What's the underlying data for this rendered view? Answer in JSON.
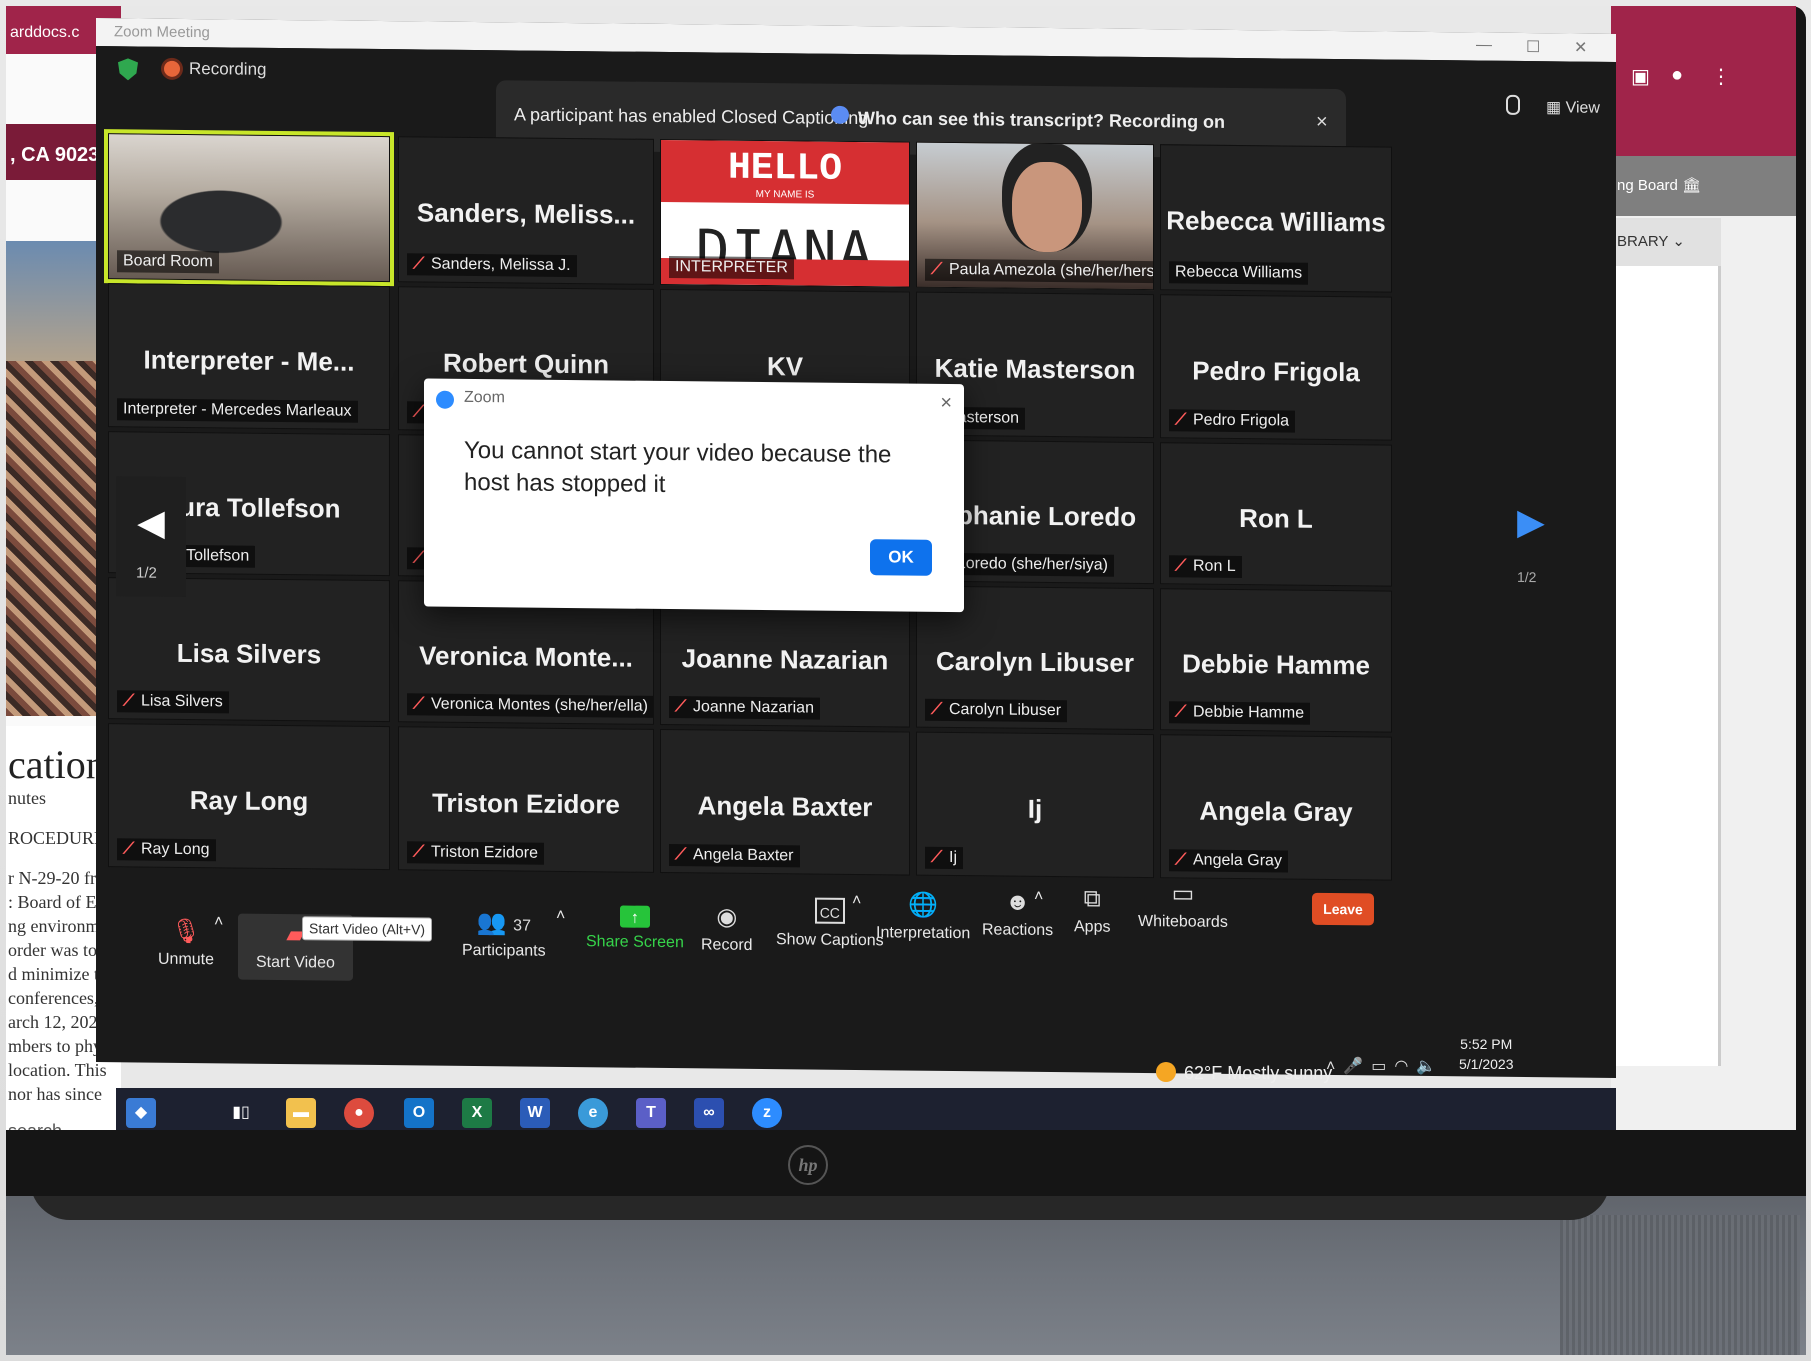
{
  "app": {
    "title": "Zoom Meeting",
    "recording_label": "Recording",
    "view_label": "View"
  },
  "banner": {
    "text": "A participant has enabled Closed Captioning",
    "link": "Who can see this transcript? Recording on",
    "close": "×"
  },
  "browser": {
    "tab_text": "arddocs.c",
    "address_text": ", CA 9023",
    "right_tab1": "ng Board",
    "right_tab2": "BRARY",
    "doc_big": "cation",
    "doc_lines": [
      "nutes",
      "ROCEDURES",
      "r N-29-20 fr",
      ": Board of Ed",
      "ng environm",
      "order was to",
      "d minimize th",
      "conferences,",
      "arch 12, 2020",
      "mbers to phy",
      "location. This",
      "nor has since"
    ],
    "search": "search"
  },
  "tiles": [
    {
      "big": "",
      "small": "Board Room",
      "muted": false,
      "kind": "board"
    },
    {
      "big": "Sanders,  Meliss...",
      "small": "Sanders, Melissa J.",
      "muted": true,
      "kind": "name"
    },
    {
      "big": "",
      "small": "INTERPRETER",
      "muted": false,
      "kind": "hello"
    },
    {
      "big": "",
      "small": "Paula Amezola (she/her/hers)",
      "muted": true,
      "kind": "paula"
    },
    {
      "big": "Rebecca Williams",
      "small": "Rebecca Williams",
      "muted": false,
      "kind": "name"
    },
    {
      "big": "Interpreter  -  Me...",
      "small": "Interpreter - Mercedes Marleaux",
      "muted": false,
      "kind": "name"
    },
    {
      "big": "Robert Quinn",
      "small": "",
      "muted": true,
      "kind": "name"
    },
    {
      "big": "KV",
      "small": "",
      "muted": false,
      "kind": "name"
    },
    {
      "big": "Katie Masterson",
      "small": "e Masterson",
      "muted": false,
      "kind": "name"
    },
    {
      "big": "Pedro Frigola",
      "small": "Pedro Frigola",
      "muted": true,
      "kind": "name"
    },
    {
      "big": ".aura Tollefson",
      "small": "Laura Tollefson",
      "muted": true,
      "kind": "name"
    },
    {
      "big": "",
      "small": "",
      "muted": true,
      "kind": "name"
    },
    {
      "big": "",
      "small": "",
      "muted": false,
      "kind": "name"
    },
    {
      "big": "tephanie Loredo",
      "small": "nie Loredo (she/her/siya)",
      "muted": false,
      "kind": "name"
    },
    {
      "big": "Ron L",
      "small": "Ron L",
      "muted": true,
      "kind": "name"
    },
    {
      "big": "Lisa Silvers",
      "small": "Lisa Silvers",
      "muted": true,
      "kind": "name"
    },
    {
      "big": "Veronica  Monte...",
      "small": "Veronica Montes (she/her/ella)",
      "muted": true,
      "kind": "name"
    },
    {
      "big": "Joanne Nazarian",
      "small": "Joanne Nazarian",
      "muted": true,
      "kind": "name"
    },
    {
      "big": "Carolyn Libuser",
      "small": "Carolyn Libuser",
      "muted": true,
      "kind": "name"
    },
    {
      "big": "Debbie Hamme",
      "small": "Debbie Hamme",
      "muted": true,
      "kind": "name"
    },
    {
      "big": "Ray Long",
      "small": "Ray Long",
      "muted": true,
      "kind": "name"
    },
    {
      "big": "Triston Ezidore",
      "small": "Triston Ezidore",
      "muted": true,
      "kind": "name"
    },
    {
      "big": "Angela Baxter",
      "small": "Angela Baxter",
      "muted": true,
      "kind": "name"
    },
    {
      "big": "Ij",
      "small": "Ij",
      "muted": true,
      "kind": "name"
    },
    {
      "big": "Angela Gray",
      "small": "Angela Gray",
      "muted": true,
      "kind": "name"
    }
  ],
  "hello_badge": {
    "hello": "HELLO",
    "my_name_is": "MY NAME IS",
    "name": "DIANA"
  },
  "pagination": {
    "prev": "1/2",
    "next": "1/2"
  },
  "dialog": {
    "title": "Zoom",
    "message": "You cannot start your video because the host has stopped it",
    "ok": "OK",
    "close": "×"
  },
  "toolbar": {
    "unmute": "Unmute",
    "start_video": "Start Video",
    "tooltip": "Start Video (Alt+V)",
    "participants": "Participants",
    "participants_count": "37",
    "share_screen": "Share Screen",
    "record": "Record",
    "show_captions": "Show Captions",
    "interpretation": "Interpretation",
    "reactions": "Reactions",
    "apps": "Apps",
    "whiteboards": "Whiteboards",
    "leave": "Leave",
    "cc": "CC"
  },
  "taskbar": {
    "weather": "62°F  Mostly sunny",
    "time": "5:52 PM",
    "date": "5/1/2023"
  },
  "colors": {
    "accent_blue": "#0e72ed",
    "leave_red": "#e04d24",
    "share_green": "#26c43a",
    "mute_red": "#ff5b5b",
    "browser_brand": "#a0244a"
  }
}
